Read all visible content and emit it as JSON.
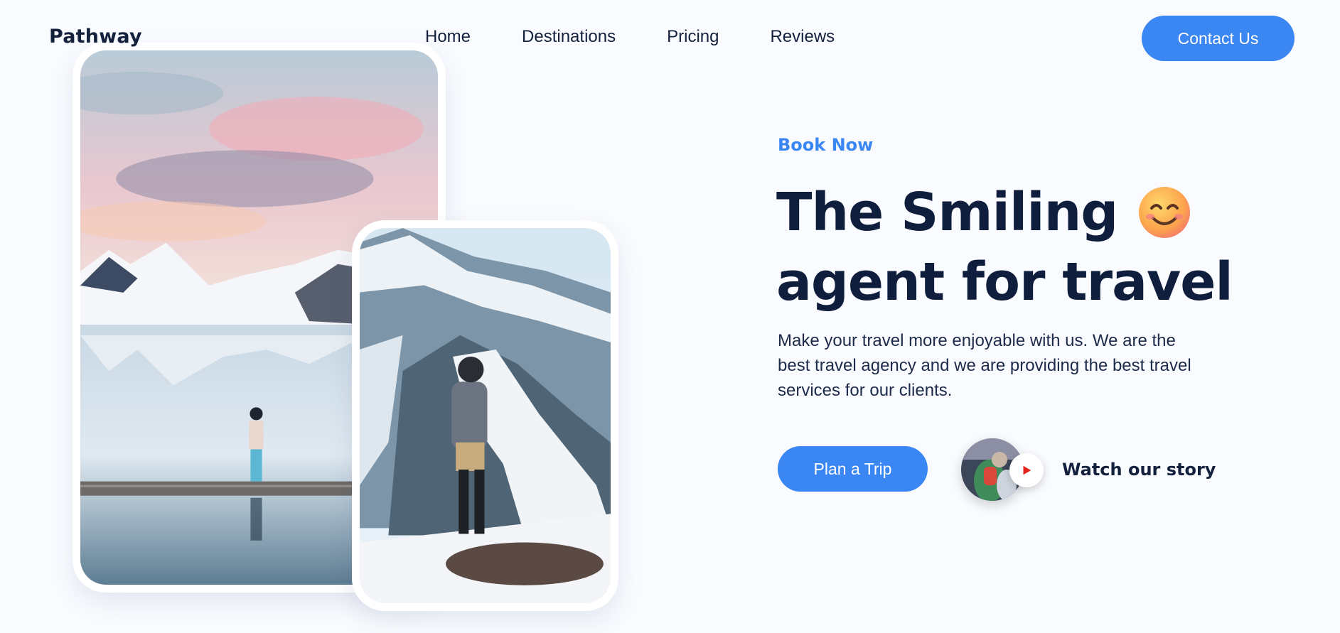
{
  "header": {
    "logo": "Pathway",
    "nav": [
      "Home",
      "Destinations",
      "Pricing",
      "Reviews"
    ],
    "cta_label": "Contact Us"
  },
  "hero": {
    "eyebrow": "Book Now",
    "headline_line1": "The Smiling",
    "headline_line2": "agent for travel",
    "emoji": "smiling-face",
    "description": "Make your travel more enjoyable with us. We are the best travel agency and we are providing the best travel services for our clients.",
    "primary_cta": "Plan a Trip",
    "story_label": "Watch our story"
  },
  "colors": {
    "accent": "#3a86f3",
    "text_dark": "#0f1e3d",
    "background": "#f9fbff",
    "play_icon": "#e5231b"
  },
  "icons": {
    "story_play": "play-icon"
  }
}
